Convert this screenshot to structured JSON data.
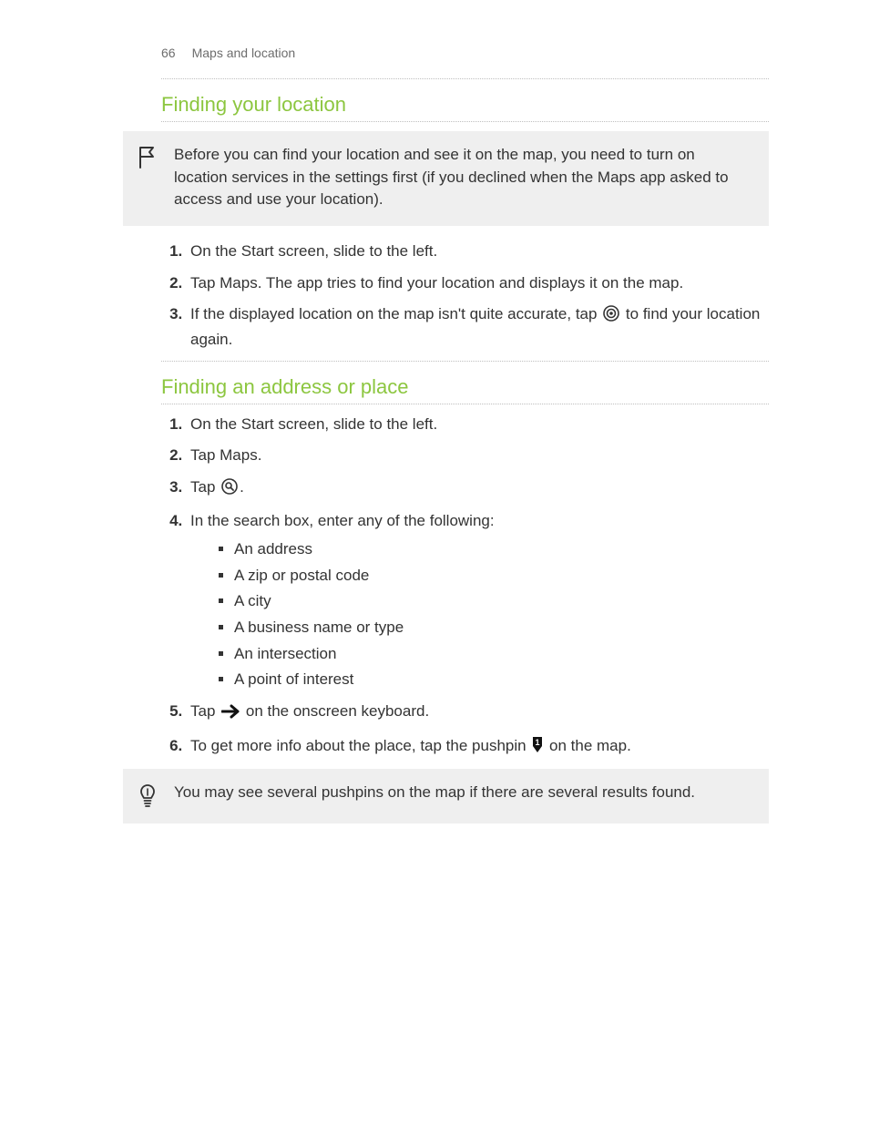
{
  "header": {
    "page_number": "66",
    "chapter": "Maps and location"
  },
  "section1": {
    "title": "Finding your location",
    "note": "Before you can find your location and see it on the map, you need to turn on location services in the settings first (if you declined when the Maps app asked to access and use your location).",
    "steps": {
      "s1": "On the Start screen, slide to the left.",
      "s2": "Tap Maps. The app tries to find your location and displays it on the map.",
      "s3_a": "If the displayed location on the map isn't quite accurate, tap ",
      "s3_b": " to find your location again."
    }
  },
  "section2": {
    "title": "Finding an address or place",
    "steps": {
      "s1": "On the Start screen, slide to the left.",
      "s2": "Tap Maps.",
      "s3_a": "Tap ",
      "s3_b": ".",
      "s4": "In the search box, enter any of the following:",
      "bullets": {
        "b1": "An address",
        "b2": "A zip or postal code",
        "b3": "A city",
        "b4": "A business name or type",
        "b5": "An intersection",
        "b6": "A point of interest"
      },
      "s5_a": "Tap ",
      "s5_b": " on the onscreen keyboard.",
      "s6_a": "To get more info about the place, tap the pushpin ",
      "s6_b": " on the map."
    },
    "tip": "You may see several pushpins on the map if there are several results found."
  }
}
